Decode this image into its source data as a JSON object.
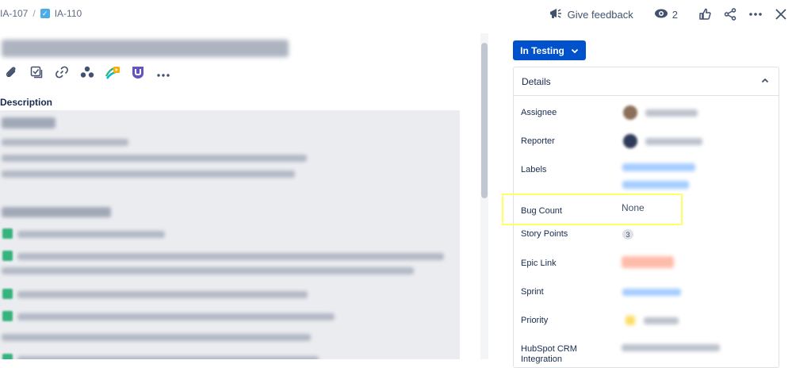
{
  "breadcrumb": {
    "parent": "IA-107",
    "separator": "/",
    "current": "IA-110"
  },
  "topbar": {
    "feedback_label": "Give feedback",
    "watch_count": "2"
  },
  "description": {
    "label": "Description"
  },
  "status": {
    "label": "In Testing"
  },
  "details": {
    "title": "Details",
    "fields": {
      "assignee": "Assignee",
      "reporter": "Reporter",
      "labels": "Labels",
      "bug_count": "Bug Count",
      "story_points": "Story Points",
      "epic_link": "Epic Link",
      "sprint": "Sprint",
      "priority": "Priority",
      "hubspot_line1": "HubSpot CRM",
      "hubspot_line2": "Integration"
    },
    "values": {
      "bug_count": "None",
      "story_points": "3"
    }
  },
  "colors": {
    "primary": "#0052cc",
    "highlight": "#ffff66",
    "text": "#172b4d"
  }
}
